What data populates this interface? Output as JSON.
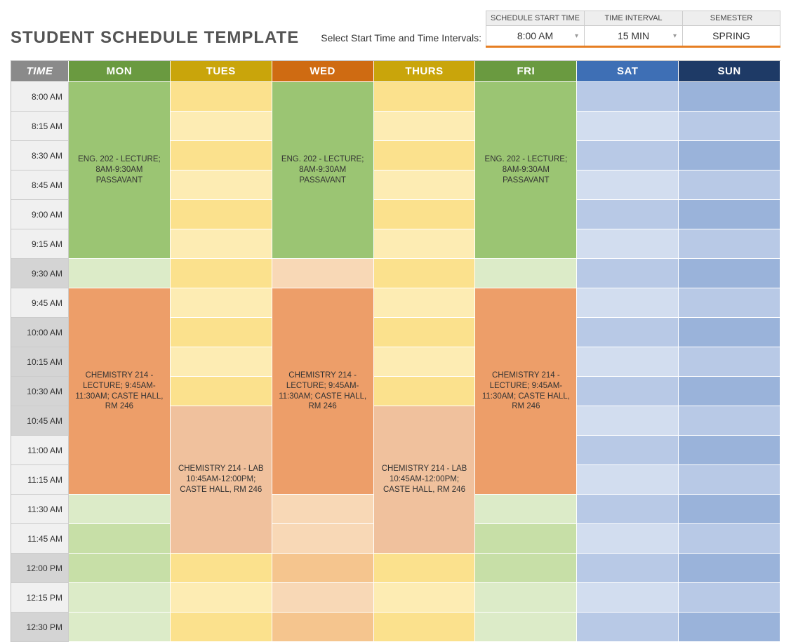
{
  "title": "STUDENT SCHEDULE TEMPLATE",
  "controls_prompt": "Select Start Time and Time Intervals:",
  "controls": {
    "start": {
      "label": "SCHEDULE START TIME",
      "value": "8:00 AM"
    },
    "interval": {
      "label": "TIME INTERVAL",
      "value": "15 MIN"
    },
    "semester": {
      "label": "SEMESTER",
      "value": "SPRING"
    }
  },
  "headers": {
    "time": "TIME",
    "mon": "MON",
    "tue": "TUES",
    "wed": "WED",
    "thu": "THURS",
    "fri": "FRI",
    "sat": "SAT",
    "sun": "SUN"
  },
  "times": [
    "8:00 AM",
    "8:15 AM",
    "8:30 AM",
    "8:45 AM",
    "9:00 AM",
    "9:15 AM",
    "9:30 AM",
    "9:45 AM",
    "10:00 AM",
    "10:15 AM",
    "10:30 AM",
    "10:45 AM",
    "11:00 AM",
    "11:15 AM",
    "11:30 AM",
    "11:45 AM",
    "12:00 PM",
    "12:15 PM",
    "12:30 PM"
  ],
  "events": {
    "eng202": "ENG. 202 - LECTURE; 8AM-9:30AM PASSAVANT",
    "chem214": "CHEMISTRY 214 - LECTURE; 9:45AM-11:30AM; CASTE HALL, RM 246",
    "chem214lab": "CHEMISTRY 214 - LAB 10:45AM-12:00PM; CASTE HALL, RM 246"
  }
}
